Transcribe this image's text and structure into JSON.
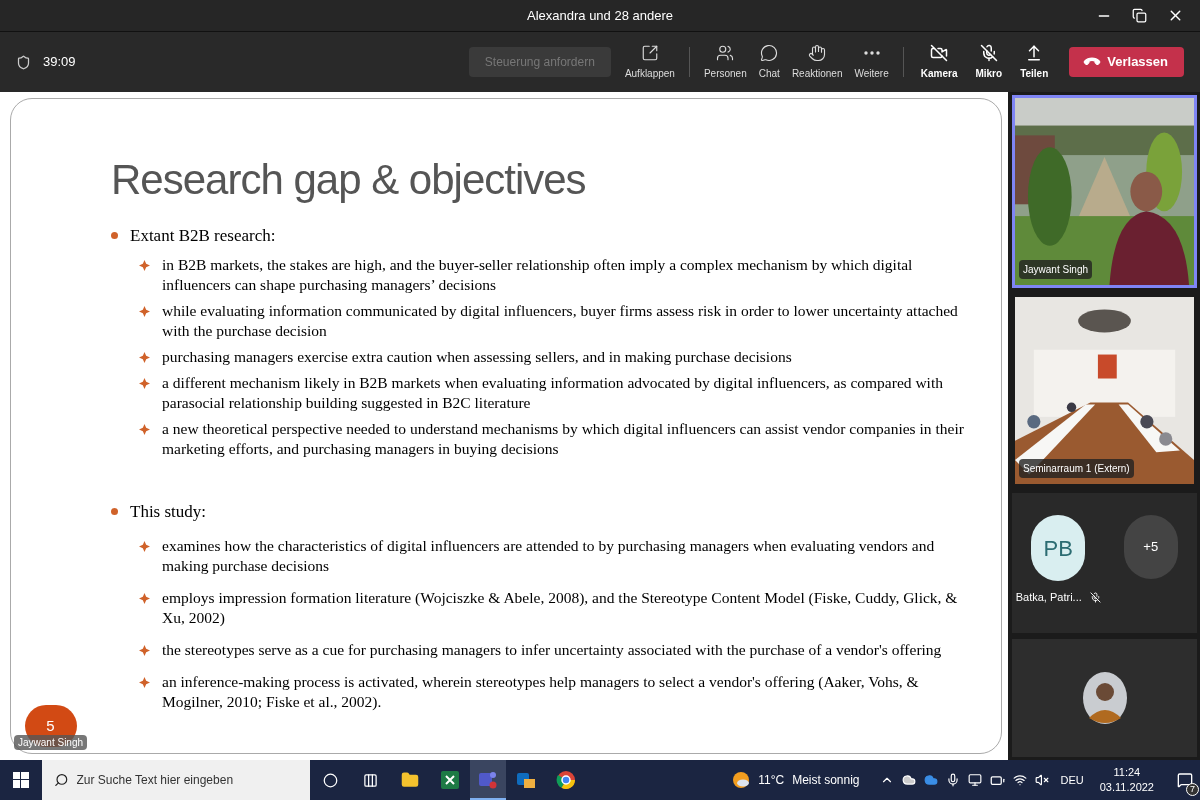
{
  "window": {
    "title": "Alexandra und 28 andere"
  },
  "meeting_bar": {
    "timer": "39:09",
    "request_control": {
      "label": "Steuerung anfordern",
      "disabled": true
    },
    "view_controls": [
      "Aufklappen",
      "Personen",
      "Chat",
      "Reaktionen",
      "Weitere"
    ],
    "device_controls": [
      "Kamera",
      "Mikro",
      "Teilen"
    ],
    "leave": "Verlassen"
  },
  "slide": {
    "title": "Research gap & objectives",
    "sections": [
      {
        "heading": "Extant B2B research:",
        "points": [
          "in B2B markets, the stakes are high, and the buyer-seller relationship often imply a complex mechanism by which digital influencers can shape purchasing managers’ decisions",
          "while evaluating information communicated by digital influencers, buyer firms assess risk in order to lower uncertainty attached with the purchase decision",
          "purchasing managers exercise extra caution when assessing sellers, and in making purchase decisions",
          "a different mechanism likely in B2B markets when evaluating information advocated by digital influencers, as compared with parasocial relationship building suggested in B2C literature",
          "a new theoretical perspective needed to understand mechanisms by which digital influencers can assist vendor companies in their marketing efforts, and purchasing managers in buying decisions"
        ]
      },
      {
        "heading": "This study:",
        "points": [
          "examines how the characteristics of digital influencers are attended to by purchasing managers when evaluating vendors and making purchase decisions",
          "employs impression formation literature (Wojciszke & Abele, 2008), and the Stereotype Content Model (Fiske, Cuddy, Glick, & Xu, 2002)",
          "the stereotypes serve as a cue for purchasing managers to infer uncertainty associated with the purchase of a vendor's offering",
          "an inference-making process is activated, wherein stereotypes help managers to select a vendor's offering (Aaker, Vohs, & Mogilner, 2010; Fiske et al., 2002)."
        ]
      }
    ],
    "reaction": {
      "count": "5",
      "name": "Jaywant Singh"
    }
  },
  "participants": [
    {
      "kind": "video",
      "name": "Jaywant Singh",
      "speaking": true
    },
    {
      "kind": "video",
      "name": "Seminarraum 1 (Extern)",
      "speaking": false
    }
  ],
  "avatars": [
    {
      "kind": "initials",
      "text": "PB",
      "name": "Batka, Patri...",
      "muted": true
    },
    {
      "kind": "overflow",
      "text": "+5"
    }
  ],
  "taskbar": {
    "search_placeholder": "Zur Suche Text hier eingeben",
    "weather": {
      "temp": "11°C",
      "text": "Meist sonnig"
    },
    "language": "DEU",
    "time": "11:24",
    "date": "03.11.2022",
    "notifications": "7"
  }
}
